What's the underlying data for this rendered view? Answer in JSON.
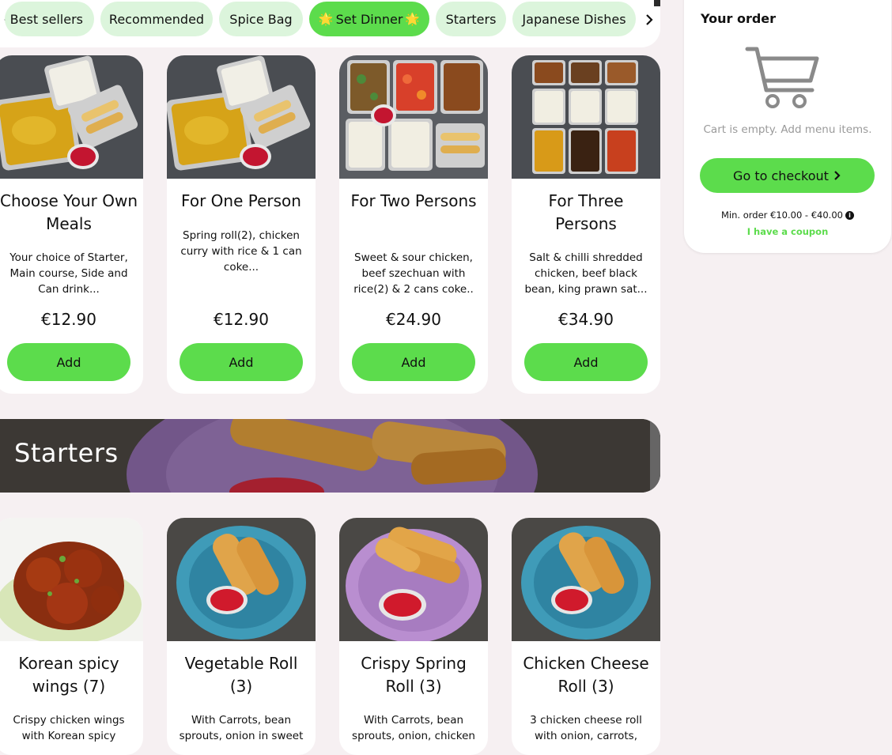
{
  "categories": {
    "items": [
      "Best sellers",
      "Recommended",
      "Spice Bag",
      "Set Dinner",
      "Starters",
      "Japanese Dishes"
    ],
    "active_star": "🌟"
  },
  "set_dinner_cards": [
    {
      "title": "Choose Your Own Meals",
      "description": "Your choice of Starter, Main course, Side and Can drink...",
      "price": "€12.90",
      "button": "Add"
    },
    {
      "title": "For One Person",
      "description": "Spring roll(2), chicken curry with rice & 1 can coke...",
      "price": "€12.90",
      "button": "Add"
    },
    {
      "title": "For Two Persons",
      "description": "Sweet & sour chicken, beef szechuan with rice(2) & 2 cans coke..",
      "price": "€24.90",
      "button": "Add"
    },
    {
      "title": "For Three Persons",
      "description": "Salt & chilli shredded chicken, beef black bean, king prawn sat...",
      "price": "€34.90",
      "button": "Add"
    }
  ],
  "starters_section": {
    "title": "Starters"
  },
  "starter_cards": [
    {
      "title": "Korean spicy wings (7)",
      "description": "Crispy chicken wings with Korean spicy"
    },
    {
      "title": "Vegetable Roll (3)",
      "description": "With Carrots, bean sprouts, onion in sweet"
    },
    {
      "title": "Crispy Spring Roll (3)",
      "description": "With Carrots, bean sprouts, onion, chicken"
    },
    {
      "title": "Chicken Cheese Roll (3)",
      "description": "3 chicken cheese roll with onion, carrots,"
    }
  ],
  "order": {
    "title": "Your order",
    "empty_text": "Cart is empty. Add menu items.",
    "checkout_label": "Go to checkout",
    "min_order": "Min. order €10.00 - €40.00",
    "coupon_label": "I have a coupon"
  },
  "colors": {
    "accent": "#5cdc4c",
    "chip_bg": "#dcf5dc",
    "page_bg": "#f6f0f2"
  },
  "icons": [
    "chevron-left-icon",
    "chevron-right-icon",
    "star-icon",
    "cart-icon",
    "info-icon"
  ]
}
